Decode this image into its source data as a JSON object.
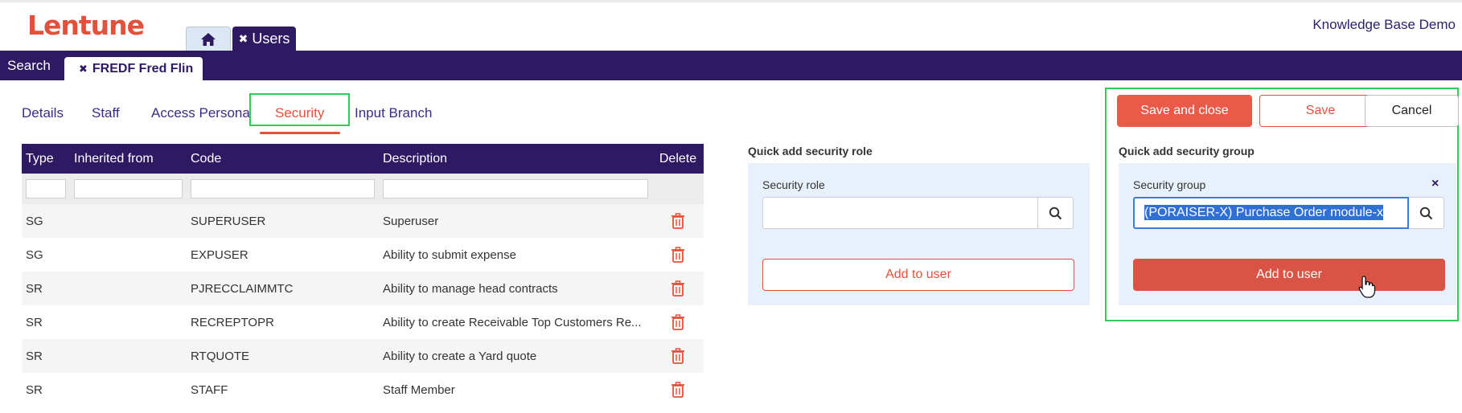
{
  "header": {
    "logo": "Lentune",
    "organization": "Knowledge Base Demo"
  },
  "app_tabs": {
    "home_icon": "home-icon",
    "users_close": "✖",
    "users_label": "Users"
  },
  "nav": {
    "search_label": "Search",
    "record_tab_close": "✖",
    "record_tab_label": "FREDF Fred Flin"
  },
  "subtabs": [
    {
      "label": "Details"
    },
    {
      "label": "Staff"
    },
    {
      "label": "Access Persona"
    },
    {
      "label": "Security"
    },
    {
      "label": "Input Branch"
    }
  ],
  "table": {
    "columns": [
      "Type",
      "Inherited from",
      "Code",
      "Description",
      "Delete"
    ],
    "rows": [
      {
        "type": "SG",
        "inherited": "",
        "code": "SUPERUSER",
        "description": "Superuser"
      },
      {
        "type": "SG",
        "inherited": "",
        "code": "EXPUSER",
        "description": "Ability to submit expense"
      },
      {
        "type": "SR",
        "inherited": "",
        "code": "PJRECCLAIMMTC",
        "description": "Ability to manage head contracts"
      },
      {
        "type": "SR",
        "inherited": "",
        "code": "RECREPTOPR",
        "description": "Ability to create Receivable Top Customers Re..."
      },
      {
        "type": "SR",
        "inherited": "",
        "code": "RTQUOTE",
        "description": "Ability to create a Yard quote"
      },
      {
        "type": "SR",
        "inherited": "",
        "code": "STAFF",
        "description": "Staff Member"
      }
    ]
  },
  "role_panel": {
    "title": "Quick add security role",
    "field_label": "Security role",
    "value": "",
    "add_label": "Add to user"
  },
  "group_panel": {
    "title": "Quick add security group",
    "field_label": "Security group",
    "value": "(PORAISER-X) Purchase Order module-x",
    "clear": "×",
    "add_label": "Add to user"
  },
  "actions": {
    "save_close": "Save and close",
    "save": "Save",
    "cancel": "Cancel"
  },
  "colors": {
    "brand_red": "#e4503c",
    "nav_purple": "#2e1a63",
    "panel_blue": "#e8f1fb",
    "highlight_green": "#34c759"
  }
}
